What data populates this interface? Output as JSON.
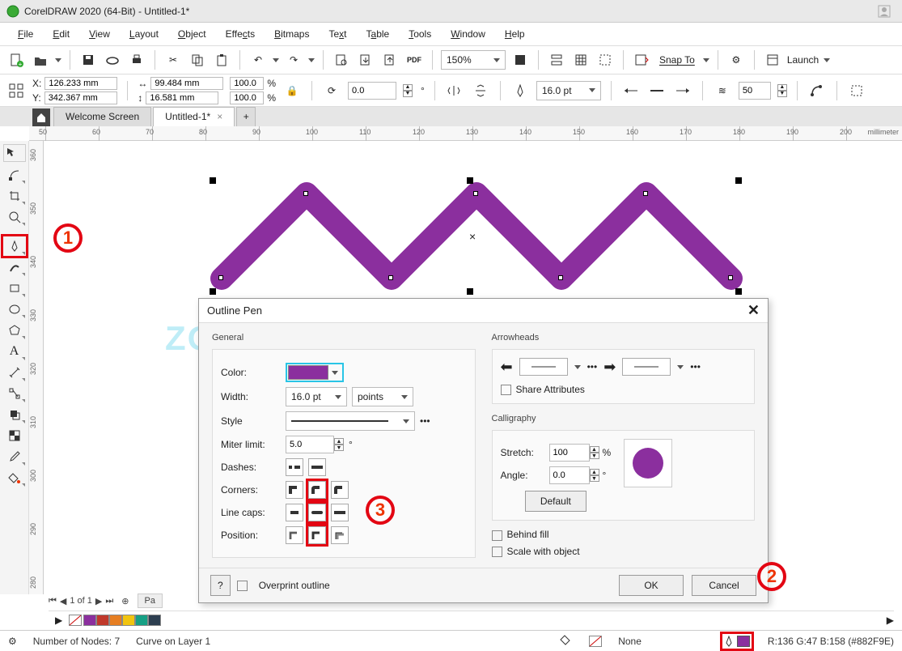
{
  "titlebar": {
    "app": "CorelDRAW 2020 (64-Bit)",
    "doc": "Untitled-1*"
  },
  "menu": [
    "File",
    "Edit",
    "View",
    "Layout",
    "Object",
    "Effects",
    "Bitmaps",
    "Text",
    "Table",
    "Tools",
    "Window",
    "Help"
  ],
  "toolbar": {
    "zoom": "150%",
    "snapto": "Snap To",
    "launch": "Launch"
  },
  "props": {
    "x": "126.233 mm",
    "y": "342.367 mm",
    "w": "99.484 mm",
    "h": "16.581 mm",
    "sx": "100.0",
    "sy": "100.0",
    "sunit": "%",
    "rot": "0.0",
    "outline_width": "16.0 pt",
    "field50": "50"
  },
  "tabs": {
    "welcome": "Welcome Screen",
    "doc": "Untitled-1*"
  },
  "ruler_h": [
    "50",
    "60",
    "70",
    "80",
    "90",
    "100",
    "110",
    "120",
    "130",
    "140",
    "150",
    "160",
    "170",
    "180",
    "190",
    "200"
  ],
  "ruler_h_unit": "millimeter",
  "ruler_v": [
    "360",
    "350",
    "340",
    "330",
    "320",
    "310",
    "300",
    "290",
    "280"
  ],
  "dialog": {
    "title": "Outline Pen",
    "general": "General",
    "color": "Color:",
    "width": "Width:",
    "style": "Style",
    "miter": "Miter limit:",
    "dashes": "Dashes:",
    "corners": "Corners:",
    "caps": "Line caps:",
    "position": "Position:",
    "width_val": "16.0 pt",
    "width_unit": "points",
    "miter_val": "5.0",
    "arrowheads": "Arrowheads",
    "share": "Share Attributes",
    "calligraphy": "Calligraphy",
    "stretch": "Stretch:",
    "stretch_val": "100",
    "stretch_unit": "%",
    "angle": "Angle:",
    "angle_val": "0.0",
    "angle_unit": "°",
    "default": "Default",
    "behind": "Behind fill",
    "scale": "Scale with object",
    "overprint": "Overprint outline",
    "ok": "OK",
    "cancel": "Cancel",
    "help": "?"
  },
  "status": {
    "nodes": "Number of Nodes: 7",
    "layer": "Curve on Layer 1",
    "fill": "None",
    "outline": "R:136 G:47 B:158 (#882F9E)"
  },
  "pagectl": "1 of 1",
  "palette": [
    "#8B2F9E",
    "#C0392B",
    "#E67E22",
    "#F1C40F",
    "#16A085",
    "#2C3E50"
  ],
  "watermark": "ZOTUTORIAL.COM",
  "annotations": {
    "a1": "1",
    "a2": "2",
    "a3": "3"
  }
}
